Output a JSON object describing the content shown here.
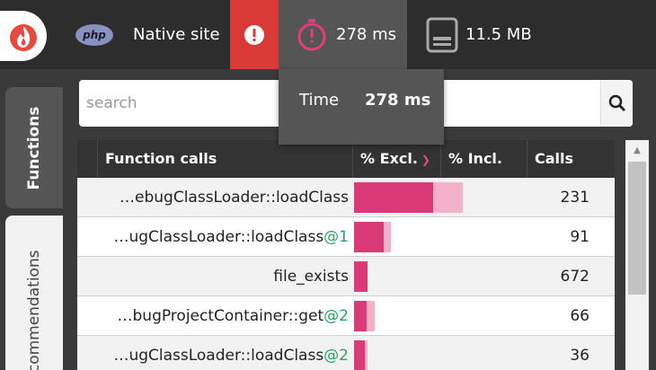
{
  "topbar": {
    "php_badge": "php",
    "site_label": "Native site",
    "alert_symbol": "!",
    "time_value": "278 ms",
    "memory_value": "11.5 MB"
  },
  "side_tabs": {
    "functions": "Functions",
    "recommendations": "ecommendations"
  },
  "search": {
    "placeholder": "search"
  },
  "table": {
    "columns": [
      "Function calls",
      "% Excl.",
      "% Incl.",
      "Calls"
    ],
    "sort_column": "% Excl.",
    "rows": [
      {
        "name": "…ebugClassLoader::loadClass",
        "suffix": "",
        "excl_pct": 46.5,
        "incl_pct": 63.5,
        "calls": "231"
      },
      {
        "name": "…ugClassLoader::loadClass",
        "suffix": "@1",
        "excl_pct": 17.5,
        "incl_pct": 21.5,
        "calls": "91"
      },
      {
        "name": "file_exists",
        "suffix": "",
        "excl_pct": 8,
        "incl_pct": 8,
        "calls": "672"
      },
      {
        "name": "…bugProjectContainer::get",
        "suffix": "@2",
        "excl_pct": 7.5,
        "incl_pct": 12,
        "calls": "66"
      },
      {
        "name": "…ugClassLoader::loadClass",
        "suffix": "@2",
        "excl_pct": 6.5,
        "incl_pct": 8,
        "calls": "36"
      }
    ]
  },
  "tooltip": {
    "label": "Time",
    "value": "278 ms"
  },
  "colors": {
    "accent": "#d93a35",
    "excl_bar": "#db3a78",
    "incl_bar": "#f2b1c9",
    "call_suffix": "#2aa361"
  }
}
